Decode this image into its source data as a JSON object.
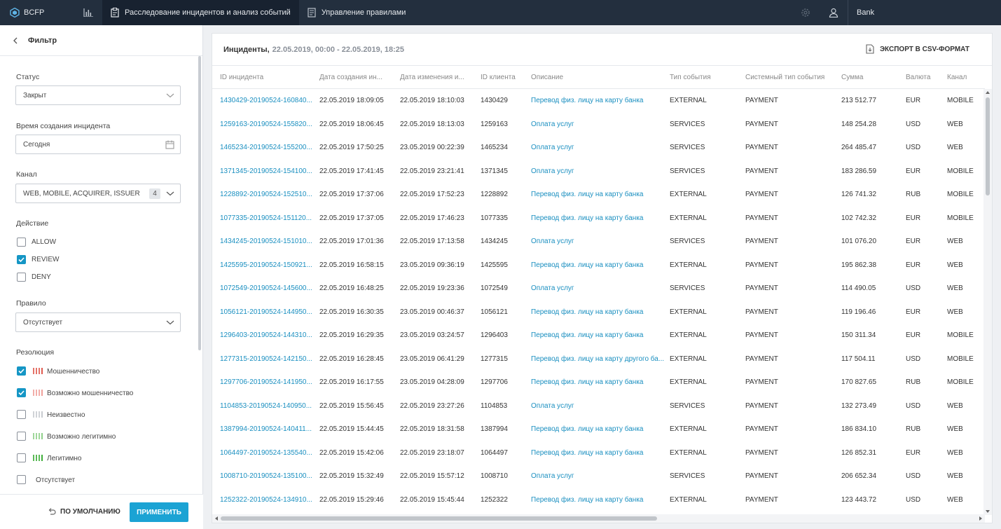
{
  "topbar": {
    "logo": "BCFP",
    "tab_investigation": "Расследование инцидентов и анализ событий",
    "tab_rules": "Управление правилами",
    "bank": "Bank"
  },
  "filter": {
    "title": "Фильтр",
    "status_label": "Статус",
    "status_value": "Закрыт",
    "time_label": "Время создания инцидента",
    "time_value": "Сегодня",
    "channel_label": "Канал",
    "channel_value": "WEB, MOBILE, ACQUIRER, ISSUER",
    "channel_count": "4",
    "action_label": "Действие",
    "actions": [
      {
        "label": "ALLOW",
        "checked": false
      },
      {
        "label": "REVIEW",
        "checked": true
      },
      {
        "label": "DENY",
        "checked": false
      }
    ],
    "rule_label": "Правило",
    "rule_value": "Отсутствует",
    "resolution_label": "Резолюция",
    "resolutions": [
      {
        "label": "Мошенничество",
        "checked": true,
        "color": "#e05a4f"
      },
      {
        "label": "Возможно мошенничество",
        "checked": true,
        "color": "#f0a09a"
      },
      {
        "label": "Неизвестно",
        "checked": false,
        "color": "#c8cbd0"
      },
      {
        "label": "Возможно легитимно",
        "checked": false,
        "color": "#8fd08a"
      },
      {
        "label": "Легитимно",
        "checked": false,
        "color": "#3fae3a"
      },
      {
        "label": "Отсутствует",
        "checked": false,
        "color": ""
      }
    ],
    "default_button": "ПО УМОЛЧАНИЮ",
    "apply_button": "ПРИМЕНИТЬ"
  },
  "incidents": {
    "title": "Инциденты,",
    "period": "22.05.2019, 00:00 - 22.05.2019, 18:25",
    "export": "ЭКСПОРТ В CSV-ФОРМАТ",
    "columns": [
      "ID инцидента",
      "Дата создания ин...",
      "Дата изменения и...",
      "ID клиента",
      "Описание",
      "Тип события",
      "Системный тип события",
      "Сумма",
      "Валюта",
      "Канал"
    ],
    "rows": [
      [
        "1430429-20190524-160840...",
        "22.05.2019 18:09:05",
        "22.05.2019 18:10:03",
        "1430429",
        "Перевод физ. лицу на карту банка",
        "EXTERNAL",
        "PAYMENT",
        "213 512.77",
        "EUR",
        "MOBILE"
      ],
      [
        "1259163-20190524-155820...",
        "22.05.2019 18:06:45",
        "22.05.2019 18:13:03",
        "1259163",
        "Оплата услуг",
        "SERVICES",
        "PAYMENT",
        "148 254.28",
        "USD",
        "WEB"
      ],
      [
        "1465234-20190524-155200...",
        "22.05.2019 17:50:25",
        "23.05.2019 00:22:39",
        "1465234",
        "Оплата услуг",
        "SERVICES",
        "PAYMENT",
        "264 485.47",
        "USD",
        "WEB"
      ],
      [
        "1371345-20190524-154100...",
        "22.05.2019 17:41:45",
        "22.05.2019 23:21:41",
        "1371345",
        "Оплата услуг",
        "SERVICES",
        "PAYMENT",
        "183 286.59",
        "EUR",
        "MOBILE"
      ],
      [
        "1228892-20190524-152510...",
        "22.05.2019 17:37:06",
        "22.05.2019 17:52:23",
        "1228892",
        "Перевод физ. лицу на карту банка",
        "EXTERNAL",
        "PAYMENT",
        "126 741.32",
        "RUB",
        "MOBILE"
      ],
      [
        "1077335-20190524-151120...",
        "22.05.2019 17:37:05",
        "22.05.2019 17:46:23",
        "1077335",
        "Перевод физ. лицу на карту банка",
        "EXTERNAL",
        "PAYMENT",
        "102 742.32",
        "EUR",
        "MOBILE"
      ],
      [
        "1434245-20190524-151010...",
        "22.05.2019 17:01:36",
        "22.05.2019 17:13:58",
        "1434245",
        "Оплата услуг",
        "SERVICES",
        "PAYMENT",
        "101 076.20",
        "EUR",
        "WEB"
      ],
      [
        "1425595-20190524-150921...",
        "22.05.2019 16:58:15",
        "23.05.2019 09:36:19",
        "1425595",
        "Перевод физ. лицу на карту банка",
        "EXTERNAL",
        "PAYMENT",
        "195 862.38",
        "EUR",
        "WEB"
      ],
      [
        "1072549-20190524-145600...",
        "22.05.2019 16:48:25",
        "22.05.2019 19:23:36",
        "1072549",
        "Оплата услуг",
        "SERVICES",
        "PAYMENT",
        "114 490.05",
        "USD",
        "WEB"
      ],
      [
        "1056121-20190524-144950...",
        "22.05.2019 16:30:35",
        "23.05.2019 00:46:37",
        "1056121",
        "Перевод физ. лицу на карту банка",
        "EXTERNAL",
        "PAYMENT",
        "119 196.46",
        "EUR",
        "WEB"
      ],
      [
        "1296403-20190524-144310...",
        "22.05.2019 16:29:35",
        "23.05.2019 03:24:57",
        "1296403",
        "Перевод физ. лицу на карту банка",
        "EXTERNAL",
        "PAYMENT",
        "150 311.34",
        "EUR",
        "MOBILE"
      ],
      [
        "1277315-20190524-142150...",
        "22.05.2019 16:28:45",
        "23.05.2019 06:41:29",
        "1277315",
        "Перевод физ. лицу на карту другого ба...",
        "EXTERNAL",
        "PAYMENT",
        "117 504.11",
        "USD",
        "MOBILE"
      ],
      [
        "1297706-20190524-141950...",
        "22.05.2019 16:17:55",
        "23.05.2019 04:28:09",
        "1297706",
        "Перевод физ. лицу на карту банка",
        "EXTERNAL",
        "PAYMENT",
        "170 827.65",
        "RUB",
        "MOBILE"
      ],
      [
        "1104853-20190524-140950...",
        "22.05.2019 15:56:45",
        "22.05.2019 23:27:26",
        "1104853",
        "Оплата услуг",
        "SERVICES",
        "PAYMENT",
        "132 273.49",
        "USD",
        "WEB"
      ],
      [
        "1387994-20190524-140411...",
        "22.05.2019 15:44:45",
        "22.05.2019 18:31:58",
        "1387994",
        "Перевод физ. лицу на карту банка",
        "EXTERNAL",
        "PAYMENT",
        "186 834.10",
        "RUB",
        "WEB"
      ],
      [
        "1064497-20190524-135540...",
        "22.05.2019 15:42:06",
        "22.05.2019 23:18:07",
        "1064497",
        "Перевод физ. лицу на карту банка",
        "EXTERNAL",
        "PAYMENT",
        "126 852.31",
        "EUR",
        "WEB"
      ],
      [
        "1008710-20190524-135100...",
        "22.05.2019 15:32:49",
        "22.05.2019 15:57:12",
        "1008710",
        "Оплата услуг",
        "SERVICES",
        "PAYMENT",
        "206 652.34",
        "USD",
        "WEB"
      ],
      [
        "1252322-20190524-134910...",
        "22.05.2019 15:29:46",
        "22.05.2019 15:45:44",
        "1252322",
        "Перевод физ. лицу на карту банка",
        "EXTERNAL",
        "PAYMENT",
        "123 443.72",
        "USD",
        "WEB"
      ]
    ]
  }
}
